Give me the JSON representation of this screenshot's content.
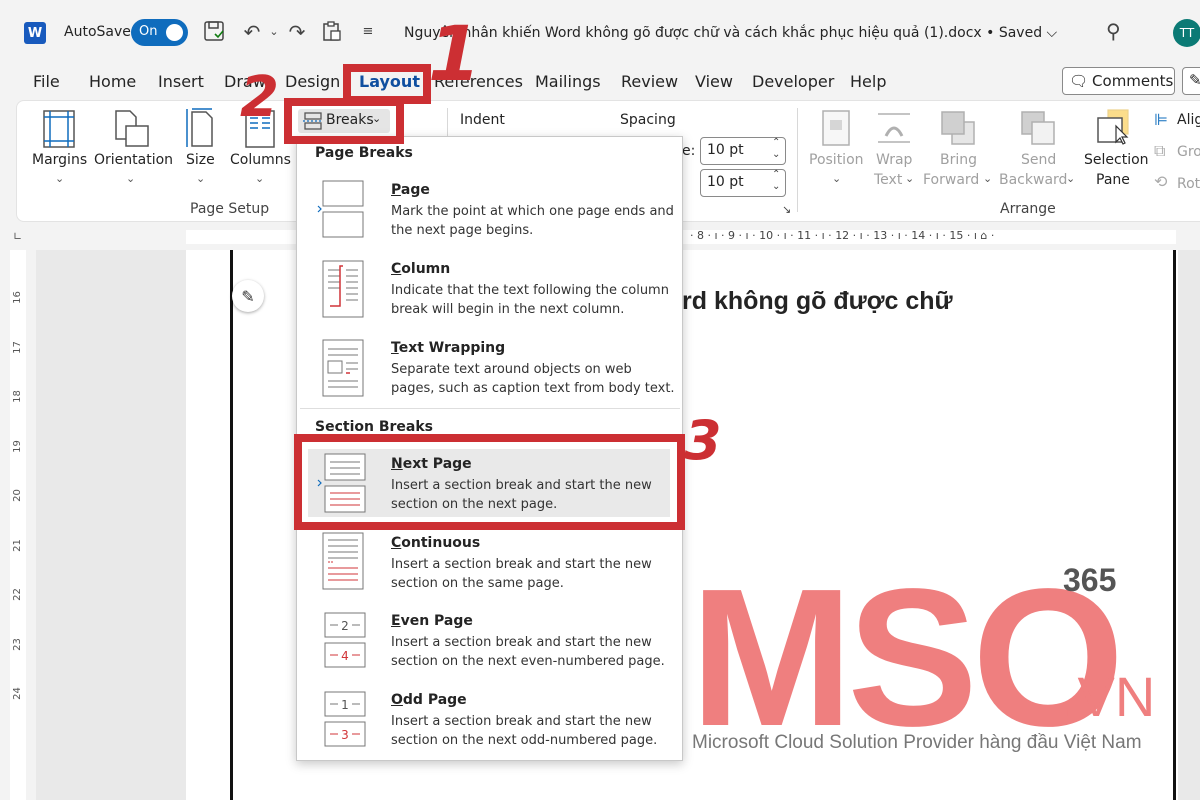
{
  "titlebar": {
    "app_icon_letter": "W",
    "autosave_label": "AutoSave",
    "autosave_state": "On",
    "doc_title": "Nguyên nhân khiến Word không gõ được chữ và cách khắc phục hiệu quả (1).docx • Saved ⌵",
    "user_initials": "TT",
    "icons": [
      "save-icon",
      "undo-icon",
      "redo-icon",
      "clipboard-icon",
      "customize-qat-icon",
      "search-icon"
    ]
  },
  "menu": {
    "tabs": [
      "File",
      "Home",
      "Insert",
      "Draw",
      "Design",
      "Layout",
      "References",
      "Mailings",
      "Review",
      "View",
      "Developer",
      "Help"
    ],
    "active_tab": "Layout",
    "comments_label": "Comments"
  },
  "ribbon": {
    "page_setup": {
      "buttons": [
        "Margins",
        "Orientation",
        "Size",
        "Columns"
      ],
      "breaks_label": "Breaks",
      "group_name": "Page Setup"
    },
    "paragraph": {
      "indent_label": "Indent",
      "spacing_label": "Spacing",
      "before_prefix": "e:",
      "spacing_before": "10 pt",
      "spacing_after": "10 pt"
    },
    "arrange": {
      "position": "Position",
      "wrap_text_1": "Wrap",
      "wrap_text_2": "Text",
      "bring_forward_1": "Bring",
      "bring_forward_2": "Forward",
      "send_backward_1": "Send",
      "send_backward_2": "Backward",
      "selection_pane_1": "Selection",
      "selection_pane_2": "Pane",
      "align": "Alig",
      "group": "Gro",
      "rotate": "Rot",
      "group_name": "Arrange"
    }
  },
  "ruler": {
    "h_numbers": [
      "8",
      "9",
      "10",
      "11",
      "12",
      "13",
      "14",
      "15"
    ],
    "v_numbers": [
      "16",
      "17",
      "18",
      "19",
      "20",
      "21",
      "22",
      "23",
      "24"
    ]
  },
  "document": {
    "heading_fragment": "rd không gõ được chữ"
  },
  "breaks_menu": {
    "page_breaks_title": "Page Breaks",
    "section_breaks_title": "Section Breaks",
    "page_break_items": [
      {
        "title": "Page",
        "desc": "Mark the point at which one page ends and the next page begins."
      },
      {
        "title": "Column",
        "desc": "Indicate that the text following the column break will begin in the next column."
      },
      {
        "title": "Text Wrapping",
        "desc": "Separate text around objects on web pages, such as caption text from body text."
      }
    ],
    "section_break_items": [
      {
        "title": "Next Page",
        "desc": "Insert a section break and start the new section on the next page."
      },
      {
        "title": "Continuous",
        "desc": "Insert a section break and start the new section on the same page."
      },
      {
        "title": "Even Page",
        "desc": "Insert a section break and start the new section on the next even-numbered page."
      },
      {
        "title": "Odd Page",
        "desc": "Insert a section break and start the new section on the next odd-numbered page."
      }
    ],
    "icon_digits": {
      "even_top": "2",
      "even_bottom": "4",
      "odd_top": "1",
      "odd_bottom": "3"
    }
  },
  "annotations": {
    "step1": "1",
    "step2": "2",
    "step3": "3"
  },
  "watermark": {
    "logo": "MSO",
    "suffix": ".VN",
    "superscript": "365",
    "tagline": "Microsoft Cloud Solution Provider hàng đầu Việt Nam"
  },
  "colors": {
    "accent_blue": "#0f6cbd",
    "annotation_red": "#cc2f33",
    "watermark_pink": "#ef7f7f",
    "avatar_teal": "#0b7a75"
  }
}
